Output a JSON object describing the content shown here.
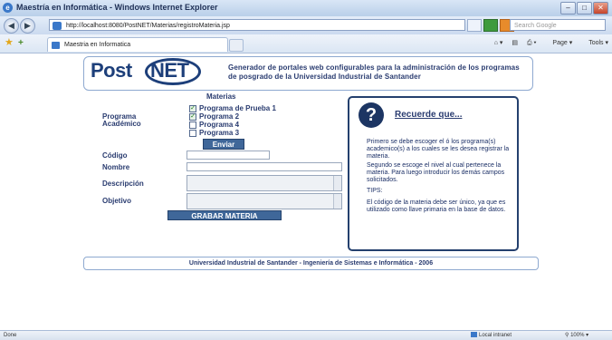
{
  "window": {
    "title": "Maestría en Informática - Windows Internet Explorer"
  },
  "address_bar": {
    "url": "http://localhost:8080/PostNET/Materias/registroMateria.jsp",
    "search_placeholder": "Search Google"
  },
  "tabs": [
    {
      "label": "Maestria en Informatica"
    }
  ],
  "command_bar": {
    "page_label": "Page",
    "tools_label": "Tools"
  },
  "logo": {
    "part1": "Post",
    "part2": "NET"
  },
  "header": {
    "description": "Generador de portales web configurables para la administración de los programas de posgrado de la Universidad Industrial de Santander"
  },
  "materias": {
    "title": "Materias",
    "programa_label": "Programa\nAcadémico",
    "options": [
      {
        "label": "Programa de Prueba 1",
        "checked": true
      },
      {
        "label": "Programa 2",
        "checked": true
      },
      {
        "label": "Programa 4",
        "checked": false
      },
      {
        "label": "Programa 3",
        "checked": false
      }
    ],
    "send_button": "Enviar"
  },
  "form": {
    "codigo_label": "Código",
    "nombre_label": "Nombre",
    "descripcion_label": "Descripción",
    "objetivo_label": "Objetivo",
    "save_button": "GRABAR MATERIA"
  },
  "reminder": {
    "title": "Recuerde que...",
    "p1": "Primero se debe escoger el ó los programa(s) academico(s) a los cuales se les desea registrar la materia.",
    "p2": "Segundo se escoge el nivel al cual pertenece la materia. Para luego introducir los demás campos solicitados.",
    "tips_label": "TIPS:",
    "p3": "El código de la materia debe ser único, ya que es utilizado como llave primaria en la base de datos."
  },
  "footer": {
    "text": "Universidad Industrial de Santander - Ingeniería de Sistemas e Informática - 2006"
  },
  "status": {
    "left": "Done",
    "zone": "Local intranet",
    "zoom": "100%"
  }
}
